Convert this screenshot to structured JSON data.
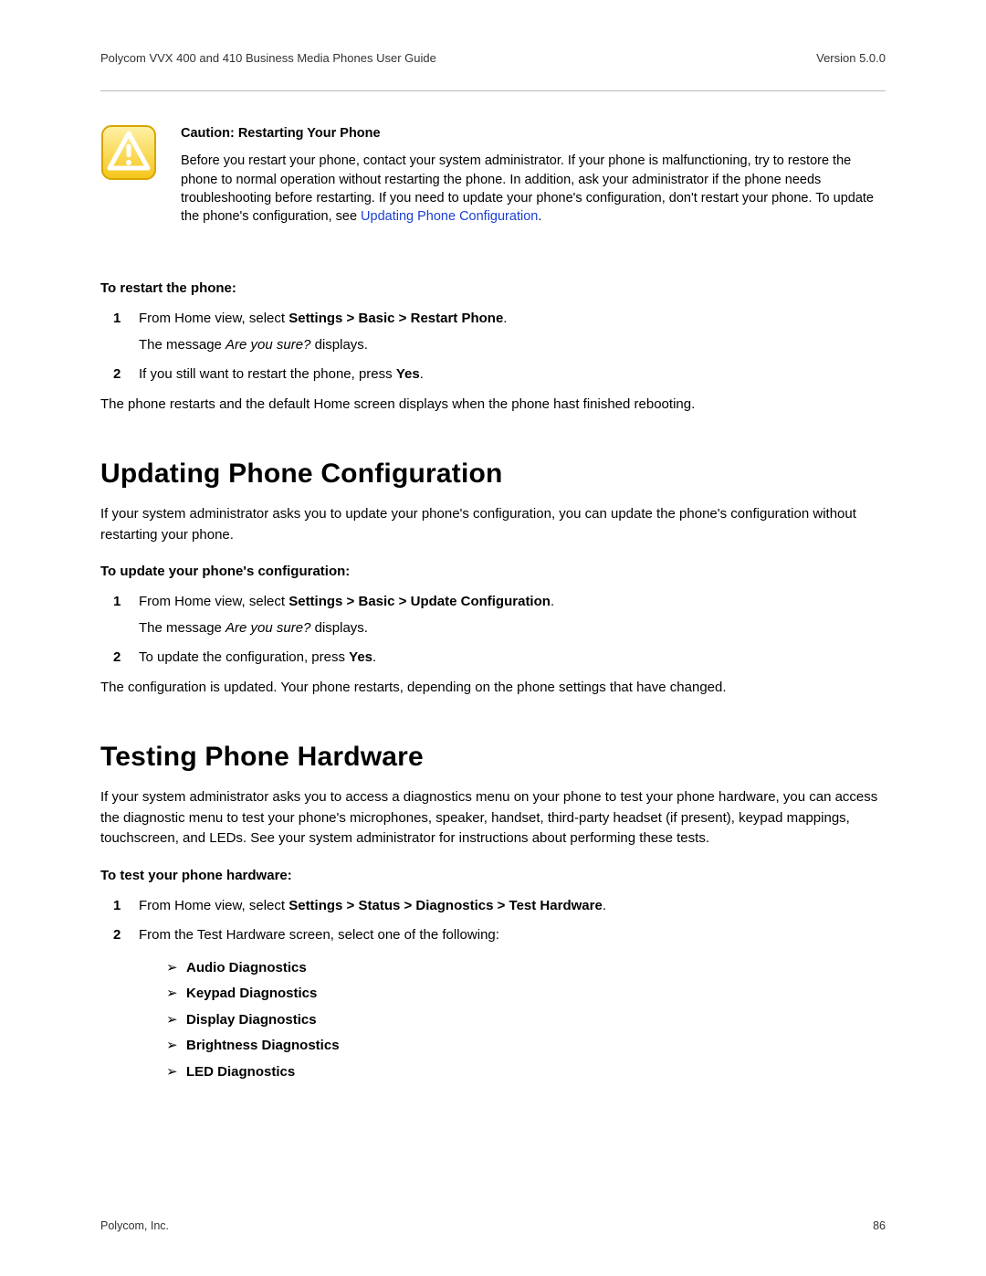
{
  "header": {
    "doc_title": "Polycom VVX 400 and 410 Business Media Phones User Guide",
    "version": "Version 5.0.0"
  },
  "caution": {
    "title": "Caution: Restarting Your Phone",
    "body_pre": "Before you restart your phone, contact your system administrator. If your phone is malfunctioning, try to restore the phone to normal operation without restarting the phone. In addition, ask your administrator if the phone needs troubleshooting before restarting. If you need to update your phone's configuration, don't restart your phone. To update the phone's configuration, see ",
    "link_text": "Updating Phone Configuration",
    "body_post": "."
  },
  "restart": {
    "lead": "To restart the phone:",
    "step1_pre": "From Home view, select ",
    "step1_bold": "Settings > Basic > Restart Phone",
    "step1_post": ".",
    "step1_sub_pre": "The message ",
    "step1_sub_italic": "Are you sure?",
    "step1_sub_post": " displays.",
    "step2_pre": "If you still want to restart the phone, press ",
    "step2_bold": "Yes",
    "step2_post": ".",
    "after": "The phone restarts and the default Home screen displays when the phone hast finished rebooting."
  },
  "updating": {
    "heading": "Updating Phone Configuration",
    "intro": "If your system administrator asks you to update your phone's configuration, you can update the phone's configuration without restarting your phone.",
    "lead": "To update your phone's configuration:",
    "step1_pre": "From Home view, select ",
    "step1_bold": "Settings > Basic > Update Configuration",
    "step1_post": ".",
    "step1_sub_pre": "The message ",
    "step1_sub_italic": "Are you sure?",
    "step1_sub_post": " displays.",
    "step2_pre": "To update the configuration, press ",
    "step2_bold": "Yes",
    "step2_post": ".",
    "after": "The configuration is updated. Your phone restarts, depending on the phone settings that have changed."
  },
  "testing": {
    "heading": "Testing Phone Hardware",
    "intro": "If your system administrator asks you to access a diagnostics menu on your phone to test your phone hardware, you can access the diagnostic menu to test your phone's microphones, speaker, handset, third-party headset (if present), keypad mappings, touchscreen, and LEDs. See your system administrator for instructions about performing these tests.",
    "lead": "To test your phone hardware:",
    "step1_pre": "From Home view, select ",
    "step1_bold": "Settings > Status > Diagnostics > Test Hardware",
    "step1_post": ".",
    "step2": "From the Test Hardware screen, select one of the following:",
    "options": [
      "Audio Diagnostics",
      "Keypad Diagnostics",
      "Display Diagnostics",
      "Brightness Diagnostics",
      "LED Diagnostics"
    ]
  },
  "footer": {
    "company": "Polycom, Inc.",
    "page_num": "86"
  },
  "nums": {
    "n1": "1",
    "n2": "2"
  },
  "arrow": "➢"
}
